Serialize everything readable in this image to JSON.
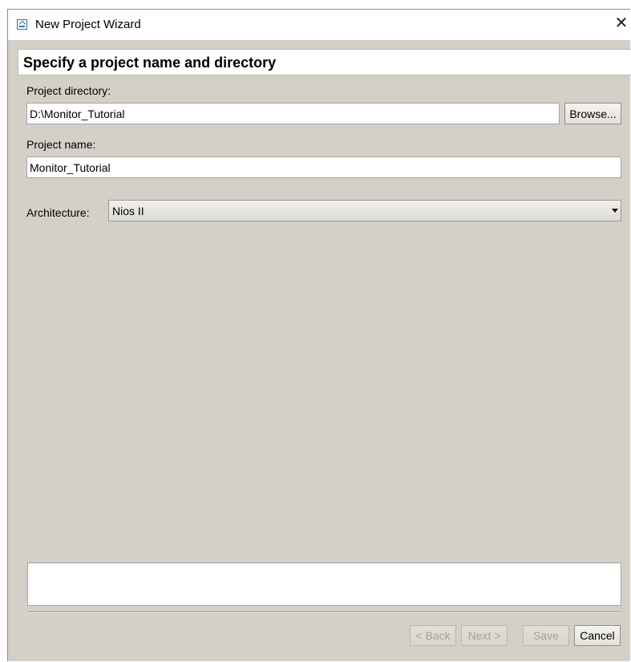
{
  "window": {
    "title": "New Project Wizard",
    "close_glyph": "✕"
  },
  "banner": {
    "heading": "Specify a project name and directory"
  },
  "form": {
    "directory_label": "Project directory:",
    "directory_value": "D:\\Monitor_Tutorial",
    "browse_label": "Browse...",
    "name_label": "Project name:",
    "name_value": "Monitor_Tutorial",
    "architecture_label": "Architecture:",
    "architecture_value": "Nios II"
  },
  "footer": {
    "back_label": "< Back",
    "next_label": "Next >",
    "save_label": "Save",
    "cancel_label": "Cancel"
  },
  "icons": {
    "app": "wizard-app-icon",
    "close": "close-icon",
    "dropdown": "chevron-down-icon"
  },
  "colors": {
    "window_bg": "#d4d0c8",
    "field_bg": "#ffffff",
    "disabled_text": "#a3a19b"
  }
}
